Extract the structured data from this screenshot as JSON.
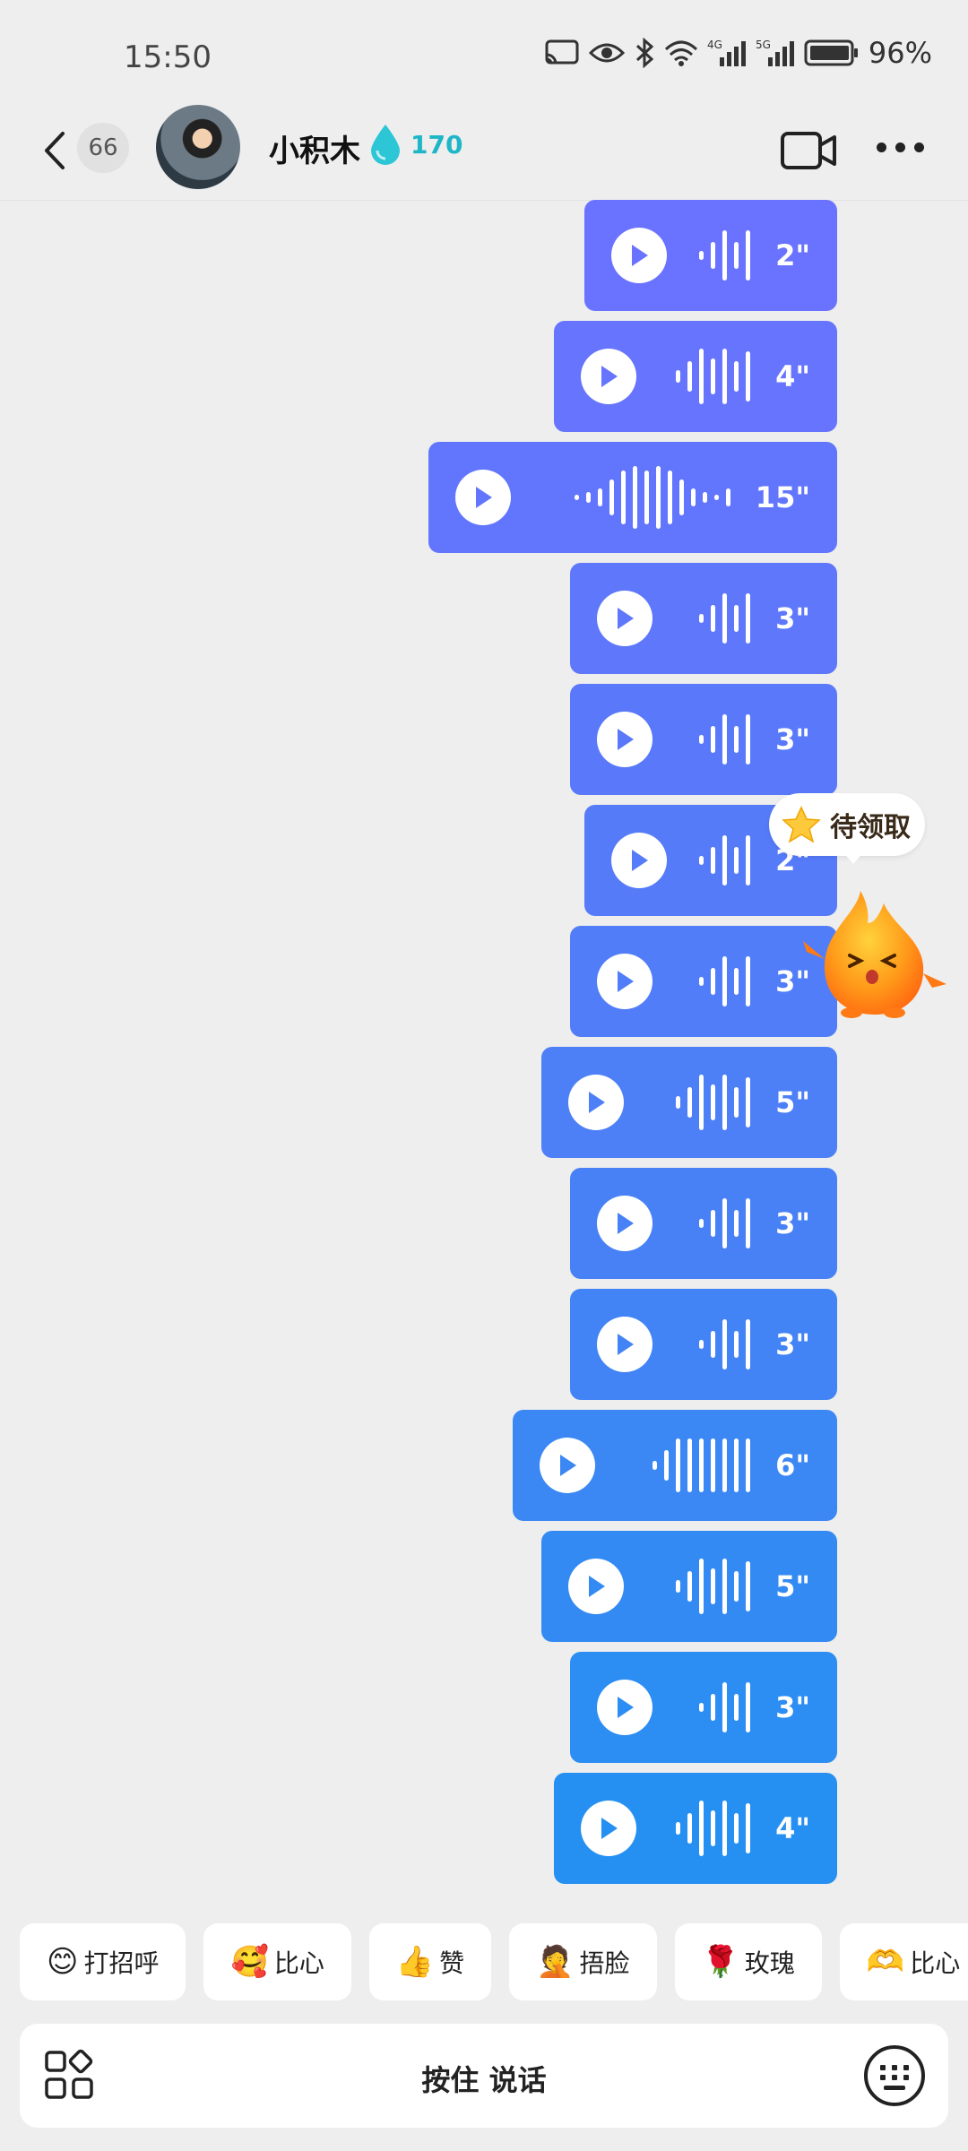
{
  "status_bar": {
    "time": "15:50",
    "battery": "96%",
    "net1": "4G",
    "net2": "5G"
  },
  "header": {
    "unread_count": "66",
    "contact_name": "小积木",
    "score": "170"
  },
  "voice_messages": [
    {
      "duration": "2\"",
      "color": "#6a73ff"
    },
    {
      "duration": "4\"",
      "color": "#6674fe"
    },
    {
      "duration": "15\"",
      "color": "#6276fd"
    },
    {
      "duration": "3\"",
      "color": "#5e77fb"
    },
    {
      "duration": "3\"",
      "color": "#5a79fa"
    },
    {
      "duration": "2\"",
      "color": "#567bf9"
    },
    {
      "duration": "3\"",
      "color": "#527df8"
    },
    {
      "duration": "5\"",
      "color": "#4d7ff7"
    },
    {
      "duration": "3\"",
      "color": "#4881f6"
    },
    {
      "duration": "3\"",
      "color": "#4284f5"
    },
    {
      "duration": "6\"",
      "color": "#3b87f4"
    },
    {
      "duration": "5\"",
      "color": "#348af3"
    },
    {
      "duration": "3\"",
      "color": "#2c8df2"
    },
    {
      "duration": "4\"",
      "color": "#2590f1"
    }
  ],
  "task_badge": {
    "label": "待领取"
  },
  "quick_replies": [
    {
      "emoji": "😊",
      "label": "打招呼"
    },
    {
      "emoji": "🥰",
      "label": "比心"
    },
    {
      "emoji": "👍",
      "label": "赞"
    },
    {
      "emoji": "🤦",
      "label": "捂脸"
    },
    {
      "emoji": "🌹",
      "label": "玫瑰"
    },
    {
      "emoji": "🫶",
      "label": "比心"
    }
  ],
  "input": {
    "hold_to_talk": "按住 说话"
  }
}
